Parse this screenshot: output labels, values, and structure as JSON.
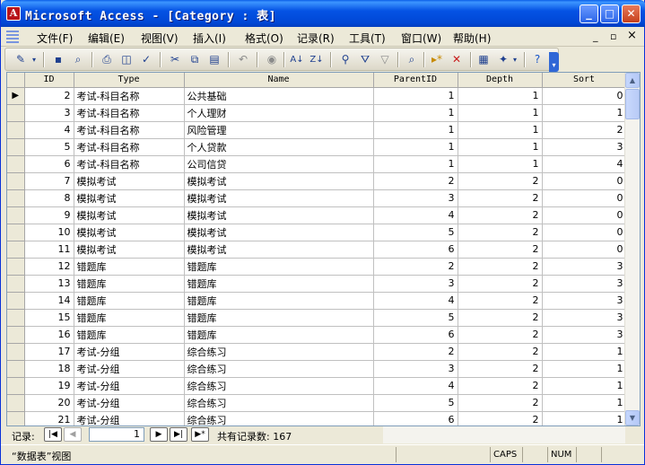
{
  "window": {
    "title": "Microsoft Access - [Category : 表]",
    "minimize_glyph": "_",
    "maximize_glyph": "□",
    "close_glyph": "✕",
    "title_color": "#0553e4",
    "close_color": "#c6401c"
  },
  "menubar": {
    "items": [
      "文件(F)",
      "编辑(E)",
      "视图(V)",
      "插入(I)",
      "格式(O)",
      "记录(R)",
      "工具(T)",
      "窗口(W)",
      "帮助(H)"
    ],
    "restore_glyph": "▫",
    "close_glyph": "×"
  },
  "toolbar": {
    "icons": [
      "design-view-icon",
      "save-icon",
      "search-icon",
      "print-icon",
      "print-preview-icon",
      "spelling-icon",
      "cut-icon",
      "copy-icon",
      "paste-icon",
      "undo-icon",
      "hyperlink-icon",
      "sort-ascending-icon",
      "sort-descending-icon",
      "filter-by-selection-icon",
      "filter-by-form-icon",
      "apply-filter-icon",
      "find-icon",
      "new-record-icon",
      "delete-record-icon",
      "database-window-icon",
      "new-object-icon",
      "help-icon"
    ]
  },
  "table": {
    "columns": [
      "ID",
      "Type",
      "Name",
      "ParentID",
      "Depth",
      "Sort"
    ],
    "rows": [
      [
        "2",
        "考试-科目名称",
        "公共基础",
        "1",
        "1",
        "0"
      ],
      [
        "3",
        "考试-科目名称",
        "个人理财",
        "1",
        "1",
        "1"
      ],
      [
        "4",
        "考试-科目名称",
        "风险管理",
        "1",
        "1",
        "2"
      ],
      [
        "5",
        "考试-科目名称",
        "个人贷款",
        "1",
        "1",
        "3"
      ],
      [
        "6",
        "考试-科目名称",
        "公司信贷",
        "1",
        "1",
        "4"
      ],
      [
        "7",
        "模拟考试",
        "模拟考试",
        "2",
        "2",
        "0"
      ],
      [
        "8",
        "模拟考试",
        "模拟考试",
        "3",
        "2",
        "0"
      ],
      [
        "9",
        "模拟考试",
        "模拟考试",
        "4",
        "2",
        "0"
      ],
      [
        "10",
        "模拟考试",
        "模拟考试",
        "5",
        "2",
        "0"
      ],
      [
        "11",
        "模拟考试",
        "模拟考试",
        "6",
        "2",
        "0"
      ],
      [
        "12",
        "错题库",
        "错题库",
        "2",
        "2",
        "3"
      ],
      [
        "13",
        "错题库",
        "错题库",
        "3",
        "2",
        "3"
      ],
      [
        "14",
        "错题库",
        "错题库",
        "4",
        "2",
        "3"
      ],
      [
        "15",
        "错题库",
        "错题库",
        "5",
        "2",
        "3"
      ],
      [
        "16",
        "错题库",
        "错题库",
        "6",
        "2",
        "3"
      ],
      [
        "17",
        "考试-分组",
        "综合练习",
        "2",
        "2",
        "1"
      ],
      [
        "18",
        "考试-分组",
        "综合练习",
        "3",
        "2",
        "1"
      ],
      [
        "19",
        "考试-分组",
        "综合练习",
        "4",
        "2",
        "1"
      ],
      [
        "20",
        "考试-分组",
        "综合练习",
        "5",
        "2",
        "1"
      ],
      [
        "21",
        "考试-分组",
        "综合练习",
        "6",
        "2",
        "1"
      ]
    ],
    "current_row_marker": "▶"
  },
  "record_nav": {
    "label": "记录:",
    "current": "1",
    "total_text": "共有记录数: 167",
    "first_glyph": "|◀",
    "prev_glyph": "◀",
    "next_glyph": "▶",
    "last_glyph": "▶|",
    "new_glyph": "▶*"
  },
  "statusbar": {
    "text": "“数据表”视图",
    "caps": "CAPS",
    "num": "NUM"
  }
}
